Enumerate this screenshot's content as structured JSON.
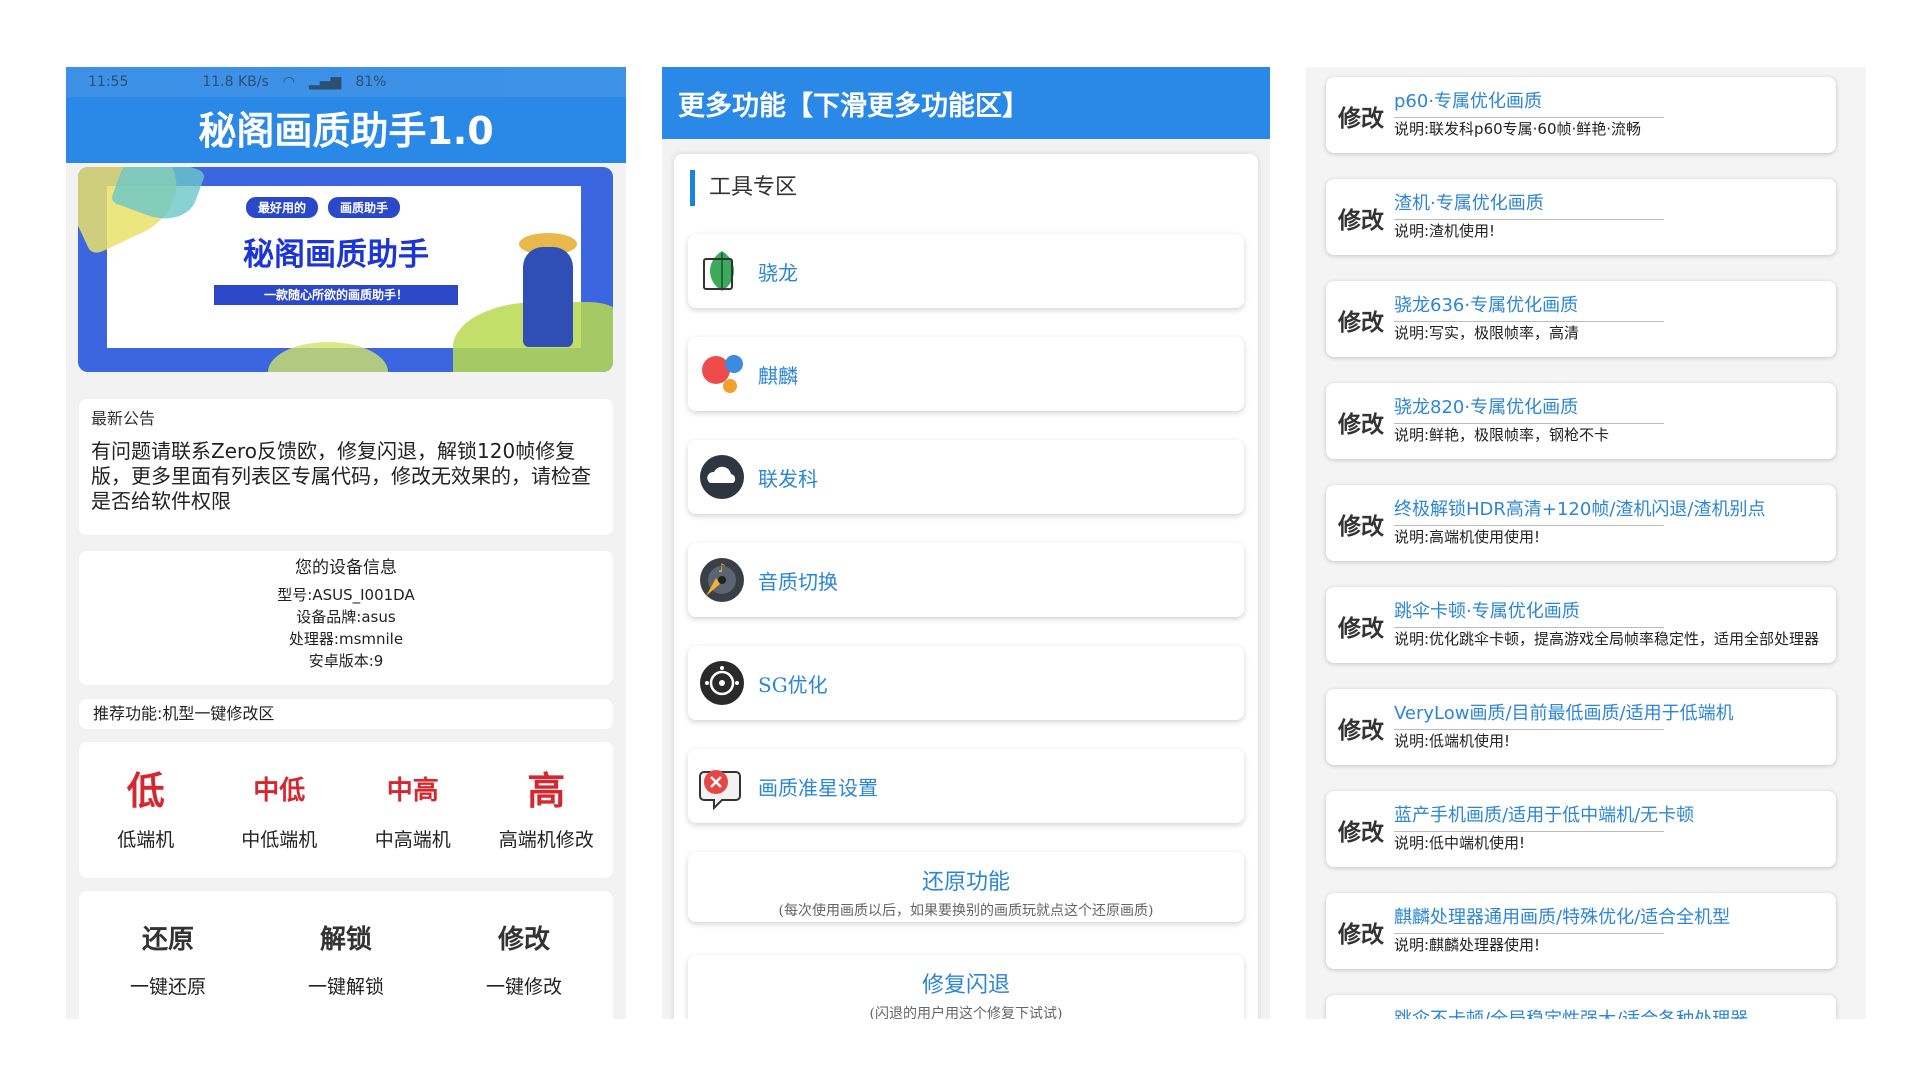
{
  "panel1": {
    "status": {
      "time": "11:55",
      "speed": "11.8 KB/s",
      "battery": "81%"
    },
    "title": "秘阁画质助手1.0",
    "banner": {
      "pill_a": "最好用的",
      "pill_b": "画质助手",
      "title": "秘阁画质助手",
      "subtitle": "一款随心所欲的画质助手！"
    },
    "notice": {
      "heading": "最新公告",
      "text": "有问题请联系Zero反馈欧，修复闪退，解锁120帧修复版，更多里面有列表区专属代码，修改无效果的，请检查是否给软件权限"
    },
    "device": {
      "heading": "您的设备信息",
      "model": "型号:ASUS_I001DA",
      "brand": "设备品牌:asus",
      "cpu": "处理器:msmnile",
      "android": "安卓版本:9"
    },
    "recommend": "推荐功能:机型一键修改区",
    "modes": [
      {
        "big": "低",
        "label": "低端机"
      },
      {
        "big": "中低",
        "label": "中低端机"
      },
      {
        "big": "中高",
        "label": "中高端机"
      },
      {
        "big": "高",
        "label": "高端机修改"
      }
    ],
    "actions": [
      {
        "big": "还原",
        "label": "一键还原"
      },
      {
        "big": "解锁",
        "label": "一键解锁"
      },
      {
        "big": "修改",
        "label": "一键修改"
      }
    ]
  },
  "panel2": {
    "title": "更多功能【下滑更多功能区】",
    "section": "工具专区",
    "tools": [
      {
        "label": "骁龙",
        "icon": "leaf-icon"
      },
      {
        "label": "麒麟",
        "icon": "bubbles-icon"
      },
      {
        "label": "联发科",
        "icon": "cloud-icon"
      },
      {
        "label": "音质切换",
        "icon": "music-disc-icon"
      },
      {
        "label": "SG优化",
        "icon": "ring-icon"
      },
      {
        "label": "画质准星设置",
        "icon": "crosshair-icon"
      }
    ],
    "restore": {
      "title": "还原功能",
      "sub": "(每次使用画质以后，如果要换别的画质玩就点这个还原画质)"
    },
    "fix": {
      "title": "修复闪退",
      "sub": "(闪退的用户用这个修复下试试)"
    }
  },
  "panel3": {
    "modify_label": "修改",
    "items": [
      {
        "title": "p60·专属优化画质",
        "desc": "说明:联发科p60专属·60帧·鲜艳·流畅"
      },
      {
        "title": "渣机·专属优化画质",
        "desc": "说明:渣机使用!"
      },
      {
        "title": "骁龙636·专属优化画质",
        "desc": "说明:写实，极限帧率，高清"
      },
      {
        "title": "骁龙820·专属优化画质",
        "desc": "说明:鲜艳，极限帧率，钢枪不卡"
      },
      {
        "title": "终极解锁HDR高清+120帧/渣机闪退/渣机别点",
        "desc": "说明:高端机使用使用!"
      },
      {
        "title": "跳伞卡顿·专属优化画质",
        "desc": "说明:优化跳伞卡顿，提高游戏全局帧率稳定性，适用全部处理器"
      },
      {
        "title": "VeryLow画质/目前最低画质/适用于低端机",
        "desc": "说明:低端机使用!"
      },
      {
        "title": "蓝产手机画质/适用于低中端机/无卡顿",
        "desc": "说明:低中端机使用!"
      },
      {
        "title": "麒麟处理器通用画质/特殊优化/适合全机型",
        "desc": "说明:麒麟处理器使用!"
      },
      {
        "title": "跳伞不卡顿/全局稳定性强大/适合各种处理器",
        "desc": ""
      }
    ]
  },
  "colors": {
    "accent": "#2a88e6",
    "link": "#2c86d6",
    "danger": "#d6272e"
  }
}
